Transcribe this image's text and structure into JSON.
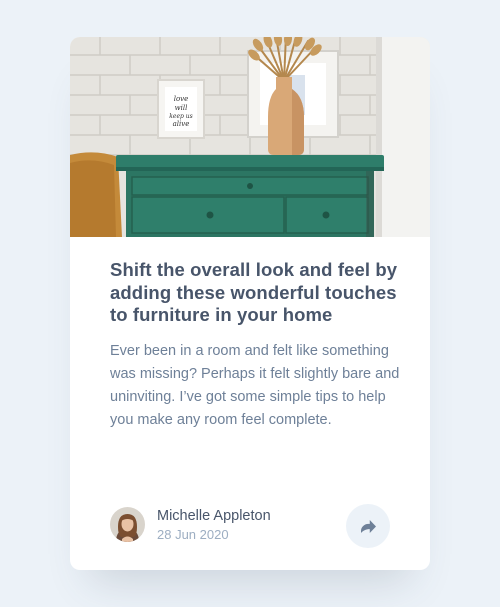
{
  "card": {
    "image_alt": "Green dresser with framed prints and a vase",
    "frame_text": "love will keep us alive",
    "title": "Shift the overall look and feel by adding these wonderful touches to furniture in your home",
    "description": "Ever been in a room and felt like something was missing? Perhaps it felt slightly bare and uninviting. I’ve got some simple tips to help you make any room feel complete."
  },
  "author": {
    "name": "Michelle Appleton",
    "date": "28 Jun 2020",
    "avatar_icon": "avatar-photo"
  },
  "share": {
    "icon": "share-icon",
    "aria_label": "Share"
  },
  "colors": {
    "background": "#ECF2F8",
    "card": "#FFFFFF",
    "title": "#48556A",
    "text": "#6E8098",
    "muted": "#9DAEC2",
    "share_bg": "#ECF2F8",
    "share_icon": "#6E8098"
  }
}
